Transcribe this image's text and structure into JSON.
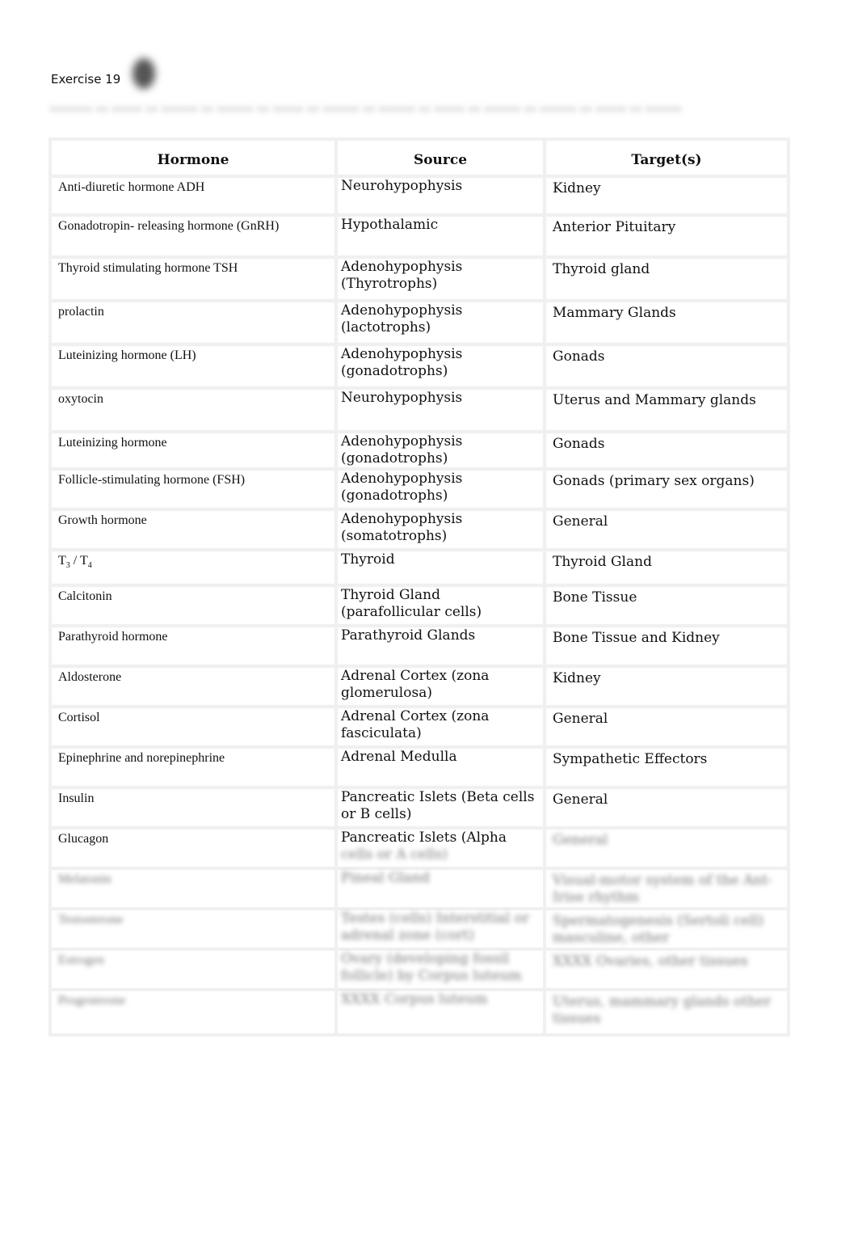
{
  "document": {
    "title": "Exercise 19",
    "subtitle_obscured": "xxxxxxx xx xxxxx xx xxxxxx xx xxxxxx xx xxxxx xx xxxxxx xx xxxxxx xx xxxxx xx xxxxxx xx xxxxxx xx xxxxx xx xxxxxx"
  },
  "table": {
    "headers": [
      "Hormone",
      "Source",
      "Target(s)"
    ],
    "rows": [
      {
        "hormone": "Anti-diuretic hormone ADH",
        "source": "Neurohypophysis",
        "target": "Kidney"
      },
      {
        "hormone": "Gonadotropin-  releasing hormone (GnRH)",
        "source": "Hypothalamic",
        "target": "Anterior Pituitary"
      },
      {
        "hormone": "Thyroid stimulating hormone TSH",
        "source": "Adenohypophysis (Thyrotrophs)",
        "target": "Thyroid gland"
      },
      {
        "hormone": "prolactin",
        "source": "Adenohypophysis (lactotrophs)",
        "target": "Mammary Glands"
      },
      {
        "hormone": "Luteinizing hormone (LH)",
        "source": "Adenohypophysis (gonadotrophs)",
        "target": "Gonads"
      },
      {
        "hormone": "oxytocin",
        "source": "Neurohypophysis",
        "target": "Uterus and Mammary glands"
      },
      {
        "hormone": "Luteinizing  hormone",
        "source": "Adenohypophysis (gonadotrophs)",
        "target": "Gonads"
      },
      {
        "hormone": "Follicle-stimulating hormone (FSH)",
        "source": "Adenohypophysis (gonadotrophs)",
        "target": "Gonads (primary sex organs)"
      },
      {
        "hormone": "Growth hormone",
        "source": "Adenohypophysis (somatotrophs)",
        "target": "General"
      },
      {
        "hormone_base": "T",
        "hormone_sub1": "3",
        "hormone_sep": " / T",
        "hormone_sub2": "4",
        "source": "Thyroid",
        "target": "Thyroid Gland"
      },
      {
        "hormone": "Calcitonin",
        "source": "Thyroid Gland (parafollicular cells)",
        "target": "Bone Tissue"
      },
      {
        "hormone": "Parathyroid  hormone",
        "source": "Parathyroid Glands",
        "target": "Bone Tissue and Kidney"
      },
      {
        "hormone": "Aldosterone",
        "source": "Adrenal Cortex (zona glomerulosa)",
        "target": "Kidney"
      },
      {
        "hormone": "Cortisol",
        "source": "Adrenal Cortex (zona fasciculata)",
        "target": "General"
      },
      {
        "hormone": "Epinephrine  and norepinephrine",
        "source": "Adrenal Medulla",
        "target": "Sympathetic Effectors"
      },
      {
        "hormone": "Insulin",
        "source": "Pancreatic Islets (Beta cells or B cells)",
        "target": "General"
      },
      {
        "hormone": "Glucagon",
        "source": "Pancreatic Islets (Alpha",
        "source_obscured": "cells or A cells)",
        "target_obscured": "General"
      }
    ],
    "obscured_rows": [
      {
        "hormone": "Melatonin",
        "source": "Pineal Gland",
        "target": "Visual-motor system of the Ant-Irise rhythm"
      },
      {
        "hormone": "Testosterone",
        "source": "Testes (cells) Interstitial or adrenal zone (cort)",
        "target": "Spermatogenesis (Sertoli cell) masculine, other"
      },
      {
        "hormone": "Estrogen",
        "source": "Ovary (developing fossil follicle) by Corpus luteum",
        "target": "XXXX Ovaries, other tissues"
      },
      {
        "hormone": "Progesterone",
        "source": "XXXX Corpus luteum",
        "target": "Uterus, mammary glands other tissues"
      }
    ]
  }
}
